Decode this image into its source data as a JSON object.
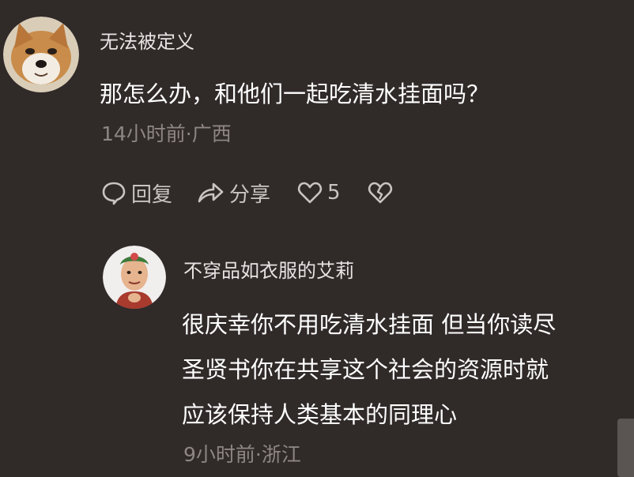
{
  "comment": {
    "avatar": "shiba-dog-avatar",
    "username": "无法被定义",
    "text": "那怎么办，和他们一起吃清水挂面吗？",
    "meta": "14小时前·广西",
    "actions": {
      "reply_label": "回复",
      "share_label": "分享",
      "like_count": "5"
    }
  },
  "reply": {
    "avatar": "person-avatar",
    "username": "不穿品如衣服的艾莉",
    "lines": [
      "很庆幸你不用吃清水挂面 但当你读尽",
      "圣贤书你在共享这个社会的资源时就",
      "应该保持人类基本的同理心"
    ],
    "meta": "9小时前·浙江"
  },
  "colors": {
    "background": "#302a29",
    "text": "#ffffff",
    "muted": "#8e8685",
    "action": "#c9c3c2"
  }
}
